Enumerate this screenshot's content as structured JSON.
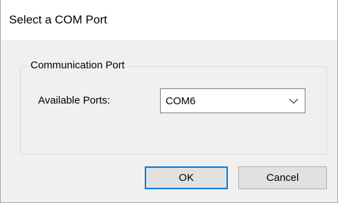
{
  "window": {
    "title": "Select a COM Port"
  },
  "group": {
    "legend": "Communication Port",
    "ports_label": "Available Ports:",
    "selected_port": "COM6",
    "options": [
      "COM6"
    ]
  },
  "buttons": {
    "ok_label": "OK",
    "cancel_label": "Cancel"
  },
  "colors": {
    "focus_border": "#0078d7",
    "dialog_background": "#f0f0f0",
    "titlebar_background": "#ffffff"
  },
  "icons": {
    "dropdown": "chevron-down-icon"
  }
}
